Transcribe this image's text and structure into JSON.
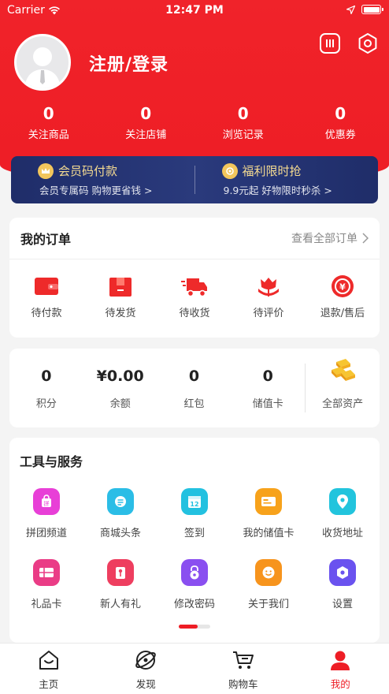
{
  "status_bar": {
    "carrier": "Carrier",
    "time": "12:47 PM"
  },
  "header": {
    "login_text": "注册/登录",
    "icons": [
      "scan-icon",
      "settings-icon"
    ]
  },
  "stats": [
    {
      "value": "0",
      "label": "关注商品"
    },
    {
      "value": "0",
      "label": "关注店铺"
    },
    {
      "value": "0",
      "label": "浏览记录"
    },
    {
      "value": "0",
      "label": "优惠券"
    }
  ],
  "vip": {
    "left": {
      "title": "会员码付款",
      "subtitle": "会员专属码 购物更省钱 >"
    },
    "right": {
      "title": "福利限时抢",
      "subtitle": "9.9元起 好物限时秒杀 >"
    }
  },
  "orders": {
    "title": "我的订单",
    "view_all": "查看全部订单",
    "items": [
      {
        "label": "待付款",
        "icon": "wallet-icon"
      },
      {
        "label": "待发货",
        "icon": "package-icon"
      },
      {
        "label": "待收货",
        "icon": "delivery-truck-icon"
      },
      {
        "label": "待评价",
        "icon": "flower-icon"
      },
      {
        "label": "退款/售后",
        "icon": "refund-icon"
      }
    ]
  },
  "assets": {
    "items": [
      {
        "value": "0",
        "label": "积分"
      },
      {
        "value": "¥0.00",
        "label": "余额"
      },
      {
        "value": "0",
        "label": "红包"
      },
      {
        "value": "0",
        "label": "储值卡"
      }
    ],
    "all_label": "全部资产"
  },
  "tools": {
    "title": "工具与服务",
    "rows": [
      [
        {
          "label": "拼团频道",
          "icon": "group-buy-icon",
          "color": "#e83fd7"
        },
        {
          "label": "商城头条",
          "icon": "news-icon",
          "color": "#2bbde6"
        },
        {
          "label": "签到",
          "icon": "calendar-icon",
          "color": "#23c1e0"
        },
        {
          "label": "我的储值卡",
          "icon": "card-icon",
          "color": "#f7a21b"
        },
        {
          "label": "收货地址",
          "icon": "location-icon",
          "color": "#22c4dd"
        }
      ],
      [
        {
          "label": "礼品卡",
          "icon": "gift-card-icon",
          "color": "#ea3c86"
        },
        {
          "label": "新人有礼",
          "icon": "gift-icon",
          "color": "#ee3e5f"
        },
        {
          "label": "修改密码",
          "icon": "lock-icon",
          "color": "#8a4ff0"
        },
        {
          "label": "关于我们",
          "icon": "smile-icon",
          "color": "#f7941d"
        },
        {
          "label": "设置",
          "icon": "hexagon-settings-icon",
          "color": "#6a52ef"
        }
      ]
    ]
  },
  "tabbar": [
    {
      "label": "主页",
      "icon": "home-icon",
      "active": false
    },
    {
      "label": "发现",
      "icon": "discover-icon",
      "active": false
    },
    {
      "label": "购物车",
      "icon": "cart-icon",
      "active": false
    },
    {
      "label": "我的",
      "icon": "user-icon",
      "active": true
    }
  ],
  "colors": {
    "brand": "#ee1d25",
    "vip_bg": "#1f2d69",
    "vip_text": "#f6dc92"
  }
}
